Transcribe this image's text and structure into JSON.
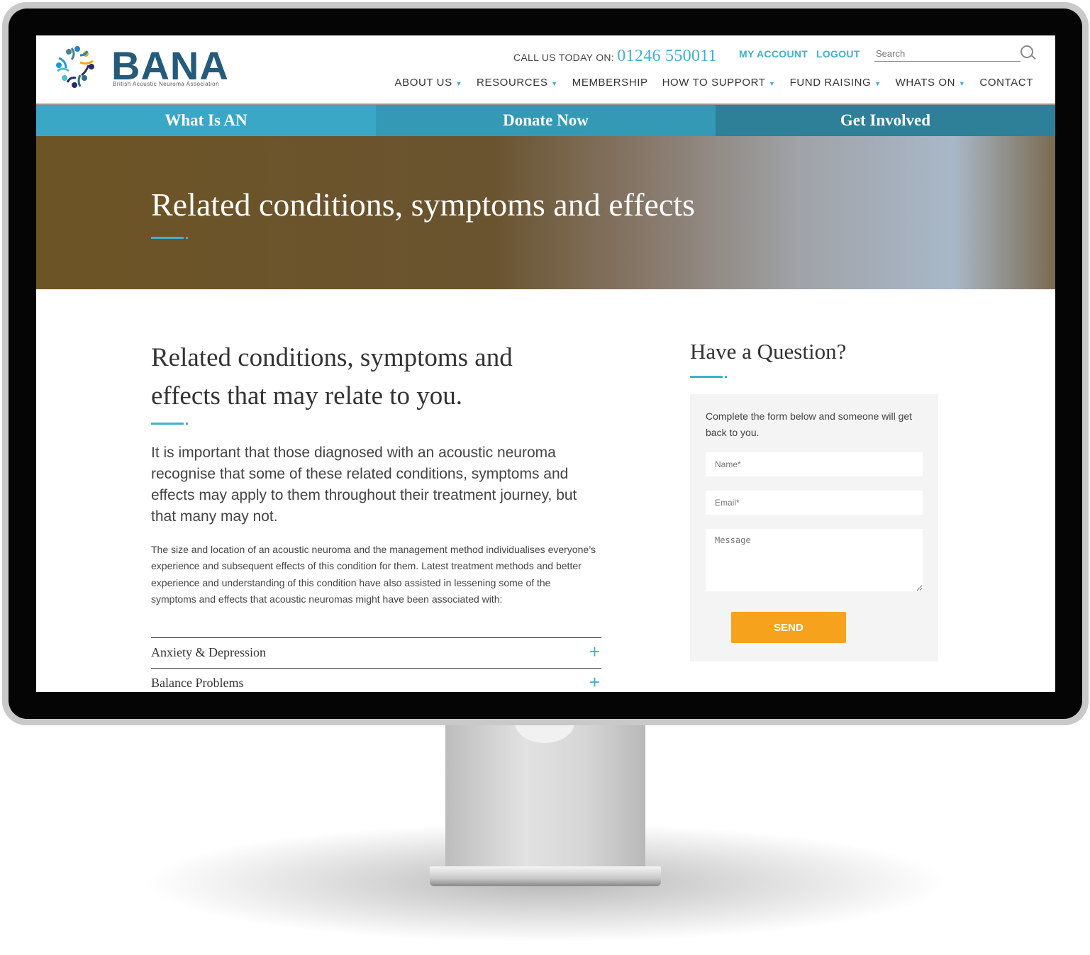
{
  "brand": {
    "name": "BANA",
    "tagline": "British Acoustic Neuroma Association"
  },
  "header": {
    "call_label": "CALL US TODAY ON:",
    "phone": "01246 550011",
    "my_account": "MY ACCOUNT",
    "logout": "LOGOUT",
    "search_placeholder": "Search"
  },
  "nav": [
    {
      "label": "ABOUT US",
      "dropdown": true
    },
    {
      "label": "RESOURCES",
      "dropdown": true
    },
    {
      "label": "MEMBERSHIP",
      "dropdown": false
    },
    {
      "label": "HOW TO SUPPORT",
      "dropdown": true
    },
    {
      "label": "FUND RAISING",
      "dropdown": true
    },
    {
      "label": "WHATS ON",
      "dropdown": true
    },
    {
      "label": "CONTACT",
      "dropdown": false
    }
  ],
  "bar": [
    {
      "label": "What Is AN",
      "color": "#3aa7c6"
    },
    {
      "label": "Donate Now",
      "color": "#3499b5"
    },
    {
      "label": "Get Involved",
      "color": "#2e8099"
    }
  ],
  "hero": {
    "title": "Related conditions, symptoms and effects"
  },
  "main": {
    "heading": "Related conditions, symptoms and effects that may relate to you.",
    "lead": "It is important that those diagnosed with an acoustic neuroma recognise that some of these related conditions, symptoms and effects may apply to them throughout their treatment journey, but that many may not.",
    "body": "The size and location of an acoustic neuroma and the management method individualises everyone’s experience and subsequent effects of this condition for them. Latest treatment methods and better experience and understanding of this condition have also assisted in lessening some of the symptoms and effects that acoustic neuromas might have been associated with:",
    "accordion": [
      "Anxiety & Depression",
      "Balance Problems"
    ]
  },
  "sidebar": {
    "title": "Have a Question?",
    "intro": "Complete the form below and someone will get back to you.",
    "name_placeholder": "Name*",
    "email_placeholder": "Email*",
    "message_placeholder": "Message",
    "send": "SEND"
  },
  "colors": {
    "accent": "#3eb1cd",
    "brand": "#245a7a",
    "button": "#f6a21c"
  }
}
